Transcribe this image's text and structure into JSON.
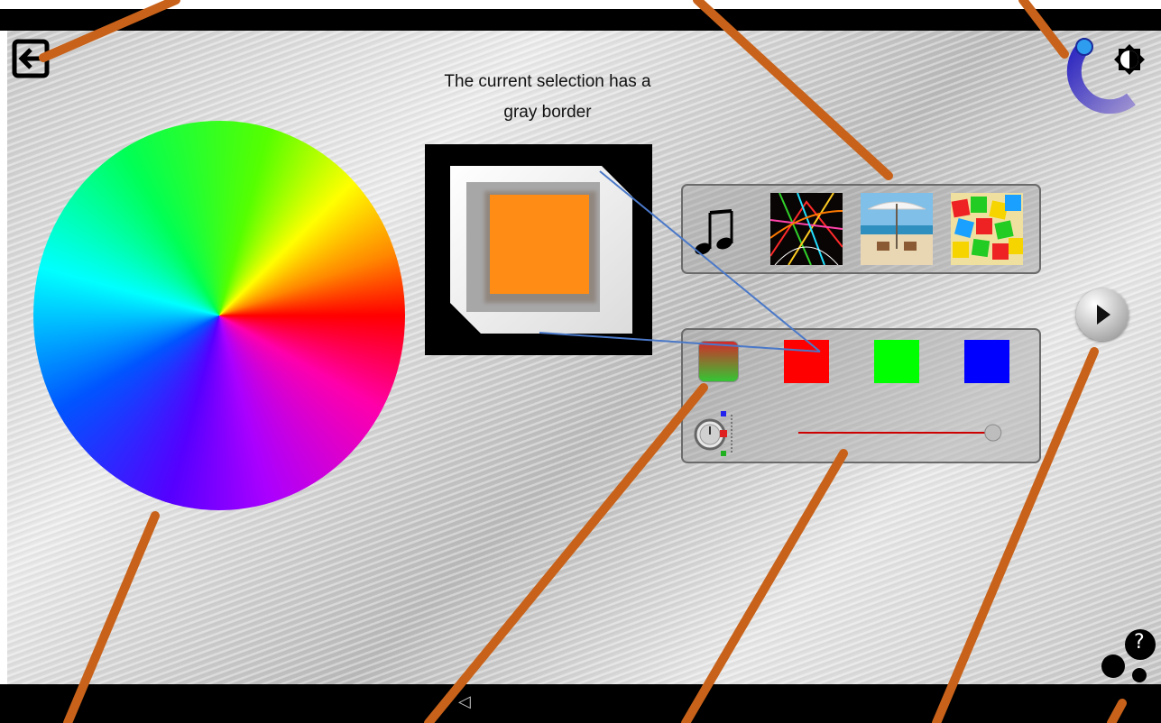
{
  "caption": "The current selection has a\ngray border",
  "icons": {
    "back": "exit-arrow-icon",
    "brightness": "brightness-dial-icon",
    "music": "music-note-icon",
    "next": "play-next-icon",
    "help": "help-bubbles-icon",
    "timer": "stopwatch-icon",
    "nav_back": "triangle-back-icon"
  },
  "nav": {
    "back_glyph": "◁"
  },
  "help": {
    "glyph": "?"
  },
  "media": [
    "fireworks",
    "beach-umbrella",
    "colored-blocks"
  ],
  "swatches": [
    {
      "name": "gradient-red-green",
      "color": "#cc2222"
    },
    {
      "name": "red",
      "color": "#ff0000"
    },
    {
      "name": "green",
      "color": "#00ff00"
    },
    {
      "name": "blue",
      "color": "#0000ff"
    }
  ],
  "slider": {
    "track_color": "#cc0000",
    "value": 0.98
  },
  "colors": {
    "annotation": "#c8621a",
    "connector": "#4a78c8",
    "dial": "#3b37c8"
  }
}
